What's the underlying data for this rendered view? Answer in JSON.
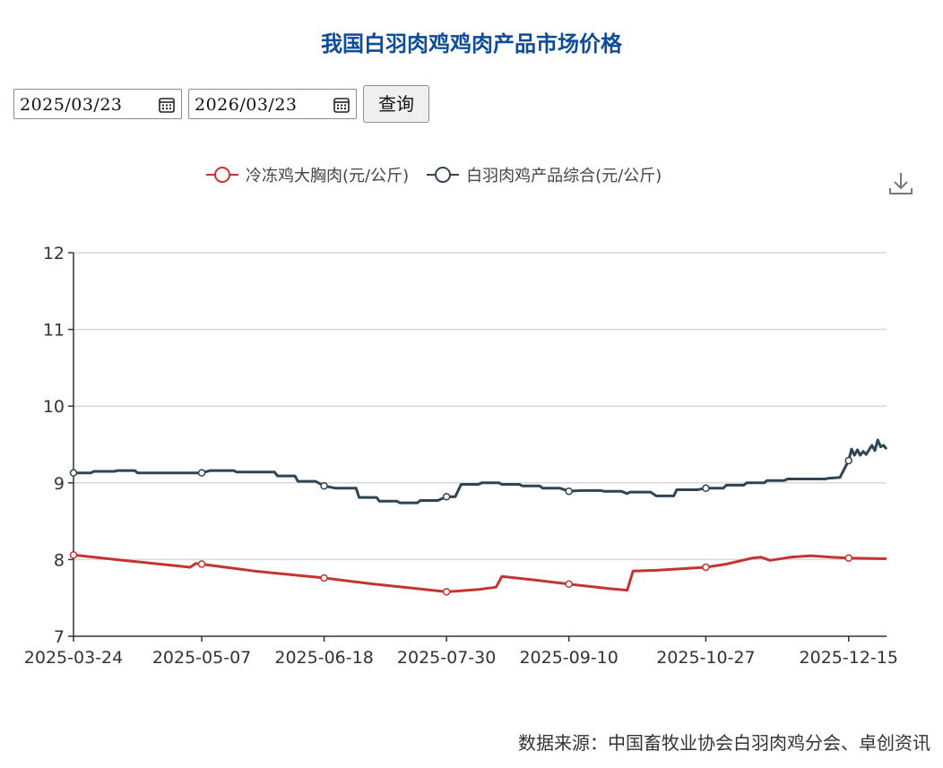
{
  "title": "我国白羽肉鸡鸡肉产品市场价格",
  "controls": {
    "start_date": "2025/03/23",
    "end_date": "2026/03/23",
    "query_label": "查询"
  },
  "source": "数据来源：中国畜牧业协会白羽肉鸡分会、卓创资讯",
  "icons": {
    "calendar": "calendar-icon",
    "download": "download-icon"
  },
  "chart_data": {
    "type": "line",
    "title": "",
    "xlabel": "",
    "ylabel": "",
    "ylim": [
      7,
      12
    ],
    "yticks": [
      7,
      8,
      9,
      10,
      11,
      12
    ],
    "xlim": [
      "2025-03-24",
      "2025-12-28"
    ],
    "xticks": [
      "2025-03-24",
      "2025-05-07",
      "2025-06-18",
      "2025-07-30",
      "2025-09-10",
      "2025-10-27",
      "2025-12-15"
    ],
    "grid": true,
    "legend_position": "top-center",
    "series": [
      {
        "name": "冷冻鸡大胸肉(元/公斤)",
        "color": "#c23531",
        "points": [
          [
            "2025-03-24",
            8.06
          ],
          [
            "2025-04-10",
            7.99
          ],
          [
            "2025-04-28",
            7.92
          ],
          [
            "2025-05-03",
            7.9
          ],
          [
            "2025-05-05",
            7.95
          ],
          [
            "2025-05-07",
            7.94
          ],
          [
            "2025-05-25",
            7.85
          ],
          [
            "2025-06-10",
            7.79
          ],
          [
            "2025-06-18",
            7.76
          ],
          [
            "2025-07-05",
            7.68
          ],
          [
            "2025-07-20",
            7.62
          ],
          [
            "2025-07-30",
            7.58
          ],
          [
            "2025-08-03",
            7.59
          ],
          [
            "2025-08-10",
            7.61
          ],
          [
            "2025-08-16",
            7.64
          ],
          [
            "2025-08-18",
            7.78
          ],
          [
            "2025-08-28",
            7.74
          ],
          [
            "2025-09-10",
            7.68
          ],
          [
            "2025-09-24",
            7.62
          ],
          [
            "2025-09-30",
            7.6
          ],
          [
            "2025-10-02",
            7.85
          ],
          [
            "2025-10-10",
            7.86
          ],
          [
            "2025-10-27",
            7.9
          ],
          [
            "2025-11-03",
            7.94
          ],
          [
            "2025-11-12",
            8.02
          ],
          [
            "2025-11-15",
            8.03
          ],
          [
            "2025-11-18",
            7.99
          ],
          [
            "2025-11-25",
            8.03
          ],
          [
            "2025-12-02",
            8.05
          ],
          [
            "2025-12-09",
            8.03
          ],
          [
            "2025-12-15",
            8.02
          ],
          [
            "2025-12-28",
            8.01
          ]
        ],
        "markers": [
          "2025-03-24",
          "2025-05-07",
          "2025-06-18",
          "2025-07-30",
          "2025-09-10",
          "2025-10-27",
          "2025-12-15"
        ]
      },
      {
        "name": "白羽肉鸡产品综合(元/公斤)",
        "color": "#2f4554",
        "points": [
          [
            "2025-03-24",
            9.13
          ],
          [
            "2025-03-30",
            9.13
          ],
          [
            "2025-03-31",
            9.15
          ],
          [
            "2025-04-07",
            9.15
          ],
          [
            "2025-04-08",
            9.16
          ],
          [
            "2025-04-14",
            9.16
          ],
          [
            "2025-04-15",
            9.13
          ],
          [
            "2025-05-07",
            9.13
          ],
          [
            "2025-05-10",
            9.16
          ],
          [
            "2025-05-18",
            9.16
          ],
          [
            "2025-05-19",
            9.14
          ],
          [
            "2025-06-01",
            9.14
          ],
          [
            "2025-06-02",
            9.09
          ],
          [
            "2025-06-08",
            9.09
          ],
          [
            "2025-06-09",
            9.02
          ],
          [
            "2025-06-15",
            9.02
          ],
          [
            "2025-06-18",
            8.96
          ],
          [
            "2025-06-22",
            8.93
          ],
          [
            "2025-06-29",
            8.93
          ],
          [
            "2025-06-30",
            8.81
          ],
          [
            "2025-07-06",
            8.81
          ],
          [
            "2025-07-07",
            8.76
          ],
          [
            "2025-07-13",
            8.76
          ],
          [
            "2025-07-14",
            8.74
          ],
          [
            "2025-07-20",
            8.74
          ],
          [
            "2025-07-21",
            8.77
          ],
          [
            "2025-07-27",
            8.77
          ],
          [
            "2025-07-30",
            8.82
          ],
          [
            "2025-08-02",
            8.82
          ],
          [
            "2025-08-04",
            8.98
          ],
          [
            "2025-08-10",
            8.98
          ],
          [
            "2025-08-11",
            9.0
          ],
          [
            "2025-08-17",
            9.0
          ],
          [
            "2025-08-18",
            8.98
          ],
          [
            "2025-08-24",
            8.98
          ],
          [
            "2025-08-25",
            8.96
          ],
          [
            "2025-08-31",
            8.96
          ],
          [
            "2025-09-01",
            8.93
          ],
          [
            "2025-09-07",
            8.93
          ],
          [
            "2025-09-10",
            8.89
          ],
          [
            "2025-09-14",
            8.9
          ],
          [
            "2025-09-21",
            8.9
          ],
          [
            "2025-09-22",
            8.89
          ],
          [
            "2025-09-28",
            8.89
          ],
          [
            "2025-09-30",
            8.86
          ],
          [
            "2025-10-01",
            8.88
          ],
          [
            "2025-10-08",
            8.88
          ],
          [
            "2025-10-10",
            8.83
          ],
          [
            "2025-10-16",
            8.83
          ],
          [
            "2025-10-17",
            8.91
          ],
          [
            "2025-10-24",
            8.91
          ],
          [
            "2025-10-27",
            8.93
          ],
          [
            "2025-11-02",
            8.93
          ],
          [
            "2025-11-03",
            8.97
          ],
          [
            "2025-11-09",
            8.97
          ],
          [
            "2025-11-10",
            9.0
          ],
          [
            "2025-11-16",
            9.0
          ],
          [
            "2025-11-17",
            9.03
          ],
          [
            "2025-11-23",
            9.03
          ],
          [
            "2025-11-24",
            9.05
          ],
          [
            "2025-12-07",
            9.05
          ],
          [
            "2025-12-08",
            9.06
          ],
          [
            "2025-12-12",
            9.07
          ],
          [
            "2025-12-15",
            9.29
          ],
          [
            "2025-12-16",
            9.44
          ],
          [
            "2025-12-17",
            9.36
          ],
          [
            "2025-12-18",
            9.43
          ],
          [
            "2025-12-19",
            9.36
          ],
          [
            "2025-12-20",
            9.41
          ],
          [
            "2025-12-21",
            9.37
          ],
          [
            "2025-12-22",
            9.43
          ],
          [
            "2025-12-23",
            9.49
          ],
          [
            "2025-12-24",
            9.42
          ],
          [
            "2025-12-25",
            9.56
          ],
          [
            "2025-12-26",
            9.47
          ],
          [
            "2025-12-27",
            9.49
          ],
          [
            "2025-12-28",
            9.44
          ]
        ],
        "markers": [
          "2025-03-24",
          "2025-05-07",
          "2025-06-18",
          "2025-07-30",
          "2025-09-10",
          "2025-10-27",
          "2025-12-15"
        ]
      }
    ]
  }
}
